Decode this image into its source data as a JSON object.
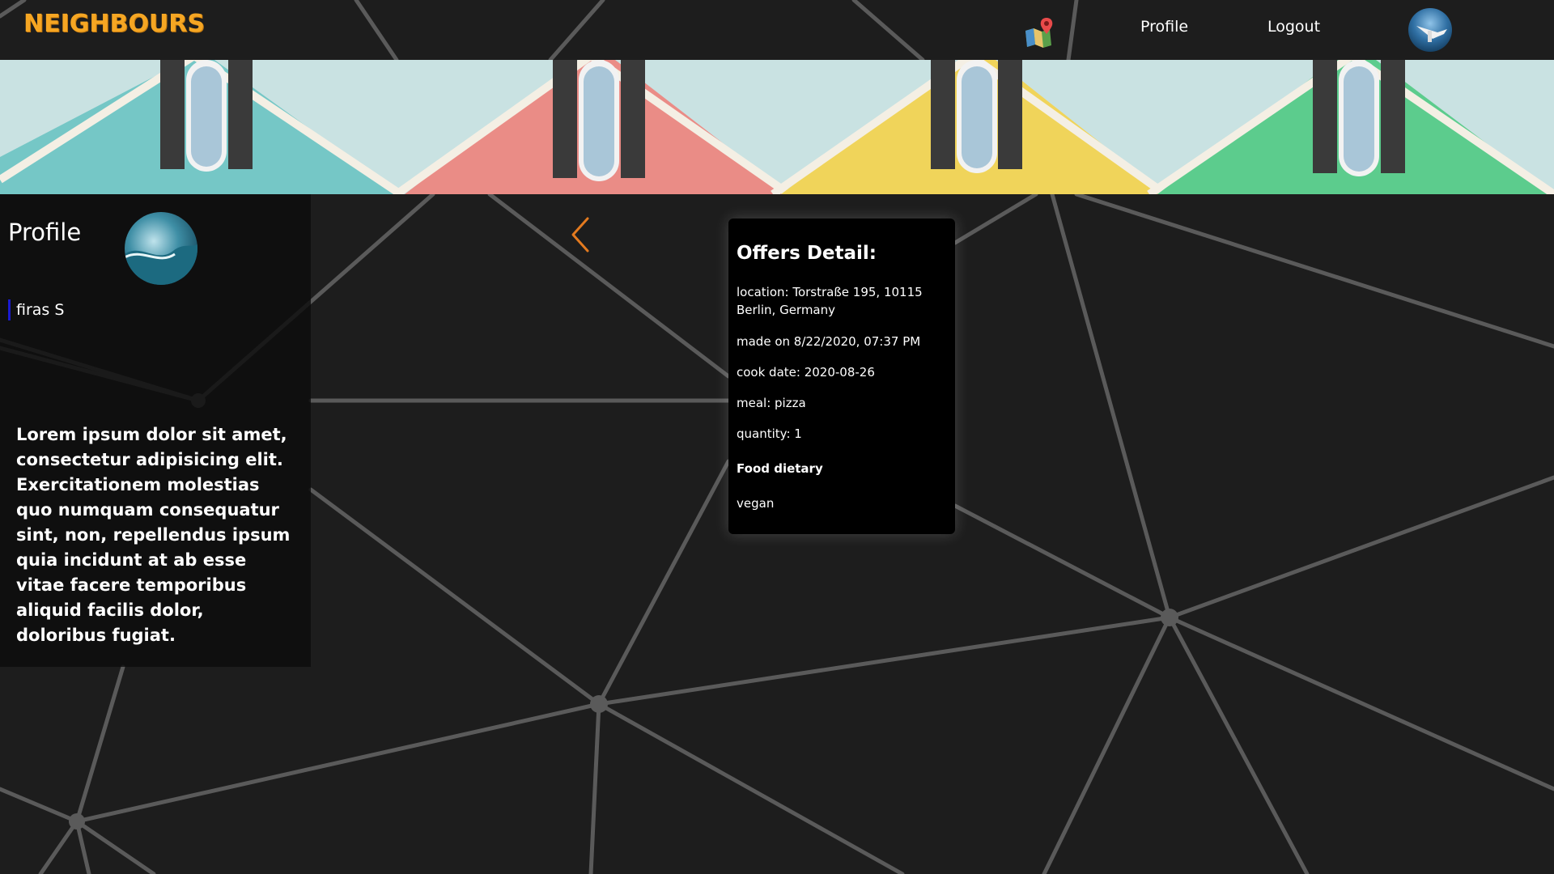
{
  "header": {
    "brand": "NEIGHBOURS",
    "map_icon": "map-pin-icon",
    "nav_profile": "Profile",
    "nav_logout": "Logout",
    "avatar": "user-avatar"
  },
  "colors": {
    "background": "#1d1d1d",
    "accent": "#f5a623",
    "back_arrow": "#e37a1f",
    "card": "#000000",
    "network_lines": "#595959"
  },
  "profile": {
    "title": "Profile",
    "name": "firas S",
    "bio": "Lorem ipsum dolor sit amet, consectetur adipisicing elit. Exercitationem molestias quo numquam consequatur sint, non, repellendus ipsum quia incidunt at ab esse vitae facere temporibus aliquid facilis dolor, doloribus fugiat."
  },
  "offer": {
    "title": "Offers Detail:",
    "location": "location: Torstraße 195, 10115 Berlin, Germany",
    "made_on": "made on 8/22/2020, 07:37 PM",
    "cook_date": "cook date: 2020-08-26",
    "meal": "meal: pizza",
    "quantity": "quantity: 1",
    "dietary_label": "Food dietary",
    "dietary_value": "vegan"
  }
}
